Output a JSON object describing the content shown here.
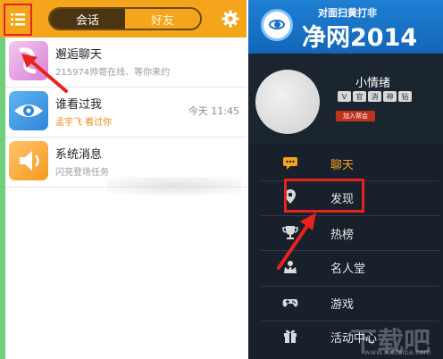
{
  "left_panel": {
    "tabs": {
      "chat": "会话",
      "friends": "好友"
    },
    "rows": [
      {
        "title": "邂逅聊天",
        "subtitle": "215974帅哥在线、等你来约",
        "time": ""
      },
      {
        "title": "谁看过我",
        "subtitle": "孟宇飞 看过你",
        "time": "今天 11:45"
      },
      {
        "title": "系统消息",
        "subtitle": "闪亮登场任务",
        "time": ""
      }
    ],
    "icons": {
      "menu": "menu-icon",
      "settings": "gear-icon"
    },
    "colors": {
      "topbar": "#f5a51c",
      "highlight": "#e8231d"
    }
  },
  "right_panel": {
    "banner": {
      "small_text": "对面扫黄打非",
      "big_text": "净网2014"
    },
    "profile": {
      "name": "小情绪",
      "badges": [
        "V",
        "官",
        "消",
        "神",
        "钻"
      ],
      "join_label": "加入帮会"
    },
    "menu": [
      {
        "label": "聊天",
        "icon": "chat-icon",
        "active": true
      },
      {
        "label": "发现",
        "icon": "location-pin-icon",
        "active": false
      },
      {
        "label": "热榜",
        "icon": "trophy-icon",
        "active": false
      },
      {
        "label": "名人堂",
        "icon": "crown-icon",
        "active": false
      },
      {
        "label": "游戏",
        "icon": "gamepad-icon",
        "active": false
      },
      {
        "label": "活动中心",
        "icon": "gift-icon",
        "active": false
      }
    ],
    "watermark": {
      "big": "下载吧",
      "small": "www.xiazaiba.com"
    },
    "colors": {
      "background": "#17202b",
      "active_label": "#f5a51c"
    }
  }
}
